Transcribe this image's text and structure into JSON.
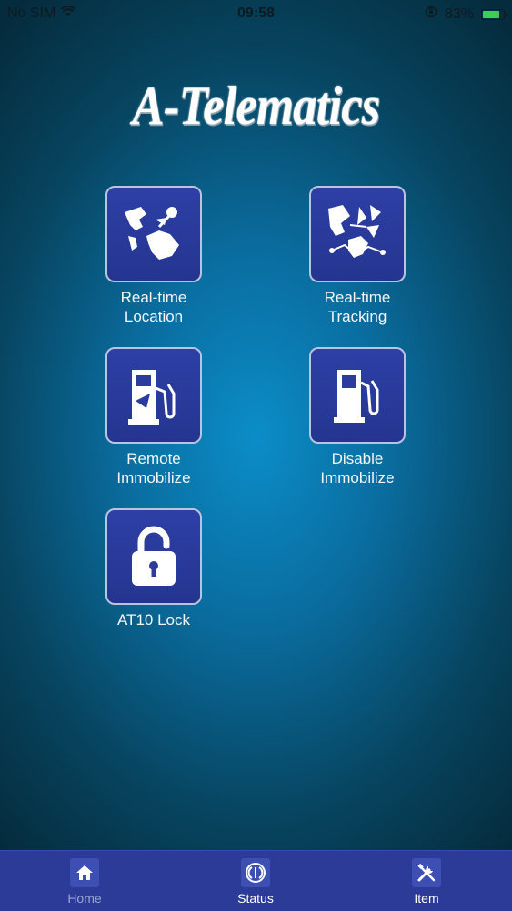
{
  "status_bar": {
    "carrier": "No SIM",
    "time": "09:58",
    "battery": "83%",
    "battery_level": 0.83
  },
  "app": {
    "logo_text": "A-Telematics"
  },
  "menu": {
    "items": [
      {
        "label": "Real-time\nLocation",
        "icon": "globe-pin-icon"
      },
      {
        "label": "Real-time\nTracking",
        "icon": "map-route-icon"
      },
      {
        "label": "Remote\nImmobilize",
        "icon": "fuel-pump-hose-icon"
      },
      {
        "label": "Disable\nImmobilize",
        "icon": "fuel-pump-icon"
      },
      {
        "label": "AT10 Lock",
        "icon": "padlock-open-icon"
      }
    ]
  },
  "tab_bar": {
    "tabs": [
      {
        "label": "Home",
        "icon": "home-icon",
        "active": true
      },
      {
        "label": "Status",
        "icon": "status-icon",
        "active": false
      },
      {
        "label": "Item",
        "icon": "tools-icon",
        "active": false
      }
    ]
  },
  "colors": {
    "tile_bg": "#2b3b9e",
    "tile_border": "#b9c4de",
    "tab_bar_bg": "#2d3b98",
    "background_center": "#0b8dc8",
    "background_edge": "#052c3d"
  }
}
